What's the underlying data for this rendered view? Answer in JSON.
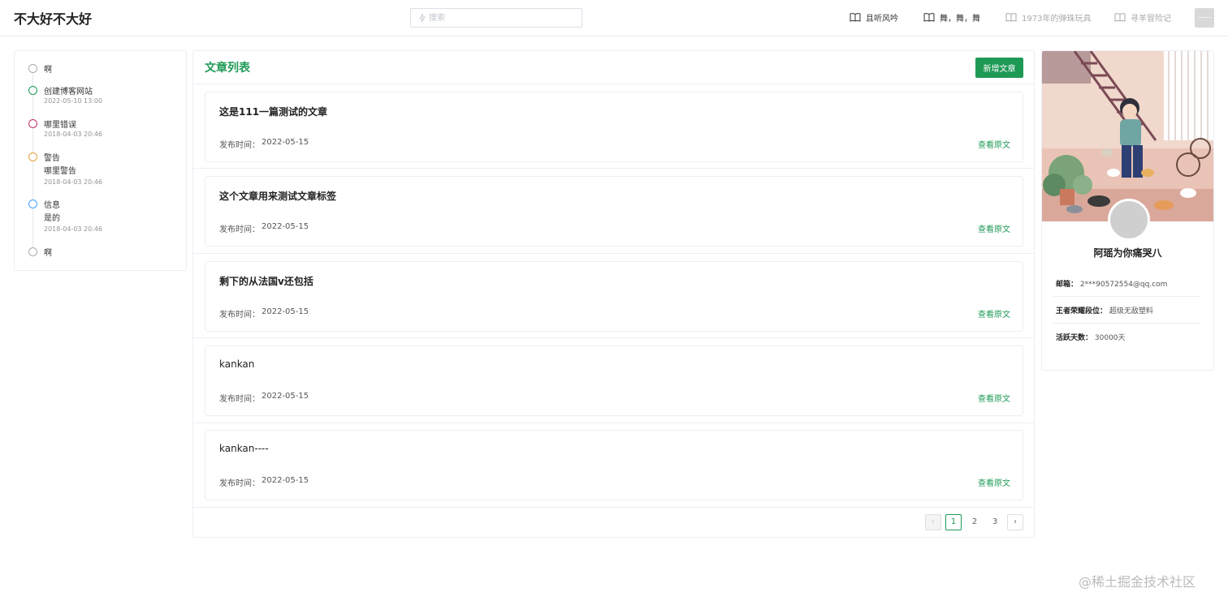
{
  "header": {
    "site_title": "不大好不大好",
    "search_placeholder": "搜索",
    "nav": [
      "且听风吟",
      "舞，舞，舞",
      "1973年的弹珠玩具",
      "寻羊冒险记"
    ]
  },
  "timeline": [
    {
      "title": "啊",
      "sub": "",
      "time": "",
      "color": "#aaaaaa"
    },
    {
      "title": "创建博客网站",
      "sub": "",
      "time": "2022-05-10 13:00",
      "color": "#1e9a55"
    },
    {
      "title": "哪里错误",
      "sub": "",
      "time": "2018-04-03 20:46",
      "color": "#c0306a"
    },
    {
      "title": "警告",
      "sub": "哪里警告",
      "time": "2018-04-03 20:46",
      "color": "#e6a23c"
    },
    {
      "title": "信息",
      "sub": "是的",
      "time": "2018-04-03 20:46",
      "color": "#409eff"
    },
    {
      "title": "啊",
      "sub": "",
      "time": "",
      "color": "#aaaaaa"
    }
  ],
  "articles_panel": {
    "title": "文章列表",
    "add_label": "新增文章",
    "date_label": "发布时间：",
    "link_label": "查看原文",
    "items": [
      {
        "title": "这是111一篇测试的文章",
        "date": "2022-05-15"
      },
      {
        "title": "这个文章用来测试文章标签",
        "date": "2022-05-15"
      },
      {
        "title": "剩下的从法国v还包括",
        "date": "2022-05-15"
      },
      {
        "title": "kankan",
        "date": "2022-05-15"
      },
      {
        "title": "kankan----",
        "date": "2022-05-15"
      }
    ]
  },
  "pagination": {
    "prev": "‹",
    "next": "›",
    "pages": [
      "1",
      "2",
      "3"
    ],
    "current": "1"
  },
  "profile": {
    "name": "阿瑶为你痛哭八",
    "rows": [
      {
        "key": "邮箱：",
        "value": "2***90572554@qq.com"
      },
      {
        "key": "王者荣耀段位：",
        "value": "超级无敌塑料"
      },
      {
        "key": "活跃天数：",
        "value": "30000天"
      }
    ]
  },
  "watermark": "@稀土掘金技术社区",
  "colors": {
    "accent": "#1e9a55"
  }
}
